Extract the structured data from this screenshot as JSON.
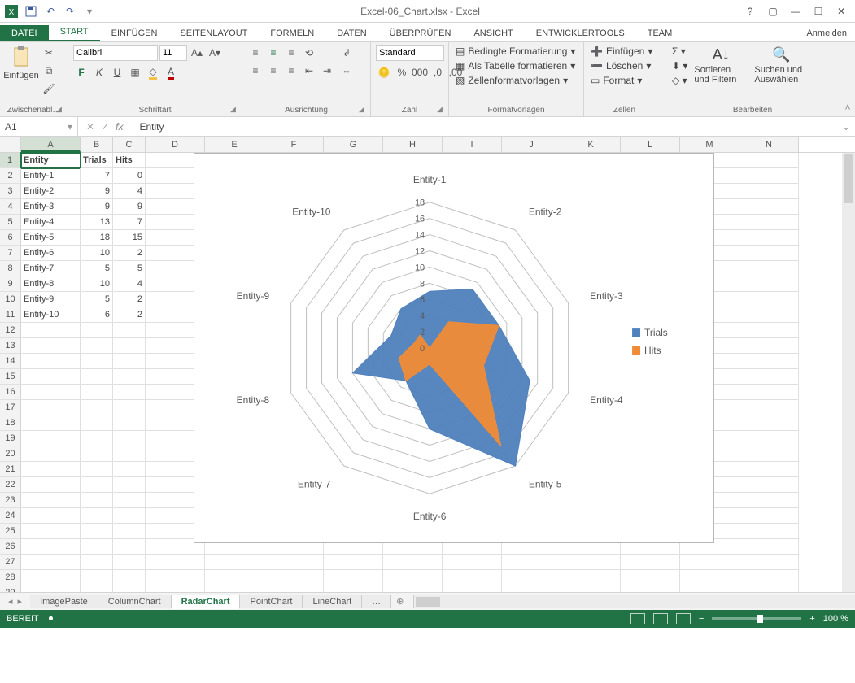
{
  "app": {
    "title": "Excel-06_Chart.xlsx - Excel",
    "signin": "Anmelden"
  },
  "tabs": {
    "file": "DATEI",
    "start": "START",
    "einfg": "EINFÜGEN",
    "seiten": "SEITENLAYOUT",
    "formeln": "FORMELN",
    "daten": "DATEN",
    "prufen": "ÜBERPRÜFEN",
    "ansicht": "ANSICHT",
    "dev": "ENTWICKLERTOOLS",
    "team": "TEAM"
  },
  "ribbon": {
    "zwisch": "Zwischenabl…",
    "einf": "Einfügen",
    "schrift": "Schriftart",
    "fontname": "Calibri",
    "fontsize": "11",
    "ausr": "Ausrichtung",
    "zeilen": "Zeilenumbruch",
    "verb": "Verbinden und zentrieren",
    "zahl": "Zahl",
    "numfmt": "Standard",
    "vorl": "Formatvorlagen",
    "bf": "Bedingte Formatierung",
    "alt": "Als Tabelle formatieren",
    "zfv": "Zellenformatvorlagen",
    "zellen": "Zellen",
    "ins": "Einfügen",
    "del": "Löschen",
    "fmt": "Format",
    "bearb": "Bearbeiten",
    "sort": "Sortieren und Filtern",
    "find": "Suchen und Auswählen"
  },
  "fb": {
    "name": "A1",
    "value": "Entity"
  },
  "cols": [
    "A",
    "B",
    "C",
    "D",
    "E",
    "F",
    "G",
    "H",
    "I",
    "J",
    "K",
    "L",
    "M",
    "N"
  ],
  "table": {
    "headers": [
      "Entity",
      "Trials",
      "Hits"
    ],
    "rows": [
      [
        "Entity-1",
        7,
        0
      ],
      [
        "Entity-2",
        9,
        4
      ],
      [
        "Entity-3",
        9,
        9
      ],
      [
        "Entity-4",
        13,
        7
      ],
      [
        "Entity-5",
        18,
        15
      ],
      [
        "Entity-6",
        10,
        2
      ],
      [
        "Entity-7",
        5,
        5
      ],
      [
        "Entity-8",
        10,
        4
      ],
      [
        "Entity-9",
        5,
        2
      ],
      [
        "Entity-10",
        6,
        2
      ]
    ]
  },
  "chart_data": {
    "type": "radar",
    "categories": [
      "Entity-1",
      "Entity-2",
      "Entity-3",
      "Entity-4",
      "Entity-5",
      "Entity-6",
      "Entity-7",
      "Entity-8",
      "Entity-9",
      "Entity-10"
    ],
    "series": [
      {
        "name": "Trials",
        "values": [
          7,
          9,
          9,
          13,
          18,
          10,
          5,
          10,
          5,
          6
        ],
        "color": "#4f81bd"
      },
      {
        "name": "Hits",
        "values": [
          0,
          4,
          9,
          7,
          15,
          2,
          5,
          4,
          2,
          2
        ],
        "color": "#f08b36"
      }
    ],
    "axis_ticks": [
      0,
      2,
      4,
      6,
      8,
      10,
      12,
      14,
      16,
      18
    ],
    "axis_max": 18
  },
  "sheets": {
    "t1": "ImagePaste",
    "t2": "ColumnChart",
    "t3": "RadarChart",
    "t4": "PointChart",
    "t5": "LineChart",
    "more": "…"
  },
  "status": {
    "ready": "BEREIT",
    "zoom": "100 %",
    "plus": "+",
    "minus": "−"
  }
}
